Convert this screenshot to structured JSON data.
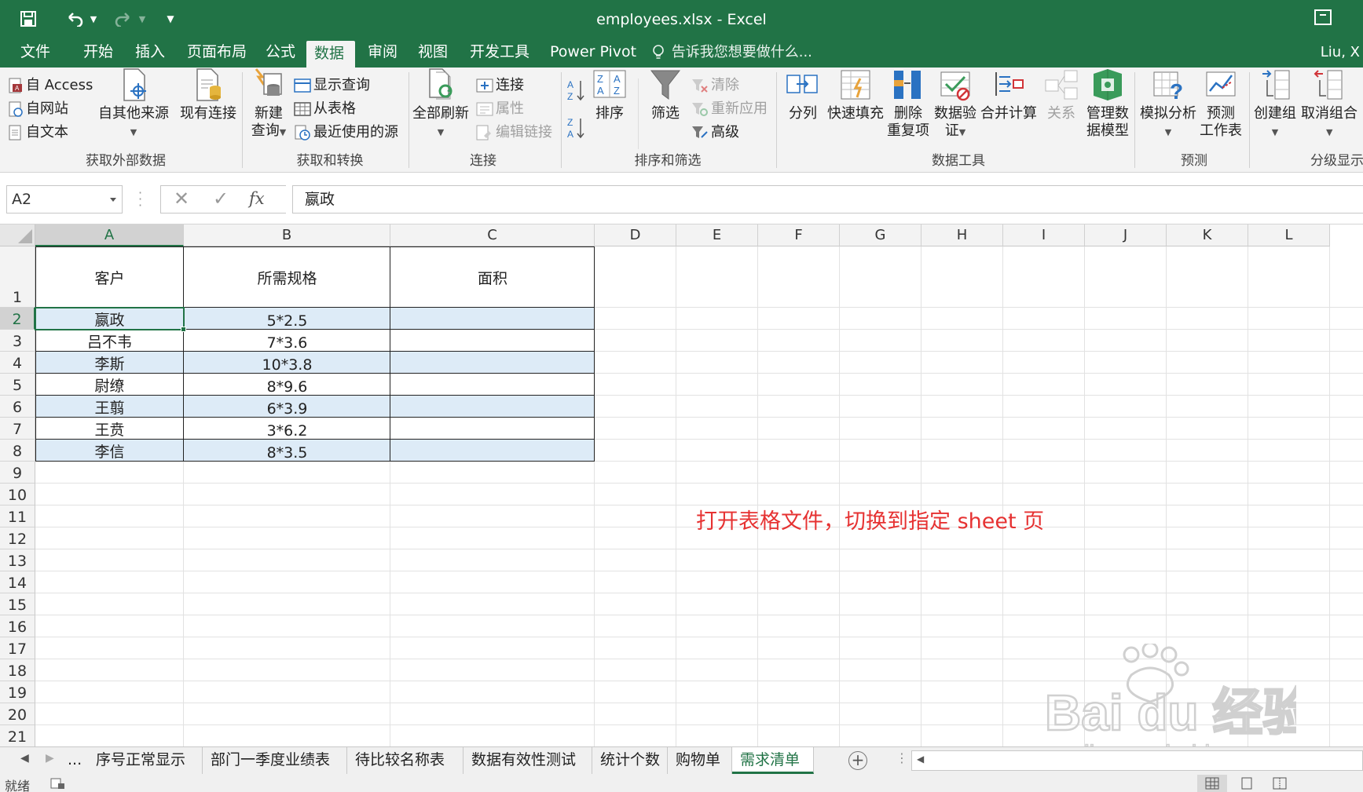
{
  "titlebar": {
    "title": "employees.xlsx - Excel",
    "bg": "#217346"
  },
  "tabs": [
    {
      "label": "文件"
    },
    {
      "label": "开始"
    },
    {
      "label": "插入"
    },
    {
      "label": "页面布局"
    },
    {
      "label": "公式"
    },
    {
      "label": "数据",
      "active": true
    },
    {
      "label": "审阅"
    },
    {
      "label": "视图"
    },
    {
      "label": "开发工具"
    },
    {
      "label": "Power Pivot"
    }
  ],
  "tellme": "告诉我您想要做什么...",
  "user": "Liu, X",
  "ribbon": {
    "external": {
      "access": "自 Access",
      "web": "自网站",
      "text": "自文本",
      "other": "自其他来源",
      "existing": "现有连接",
      "label": "获取外部数据"
    },
    "transform": {
      "new_query_1": "新建",
      "new_query_2": "查询",
      "show_query": "显示查询",
      "from_table": "从表格",
      "recent": "最近使用的源",
      "label": "获取和转换"
    },
    "connections": {
      "refresh_all": "全部刷新",
      "connect": "连接",
      "properties": "属性",
      "edit_links": "编辑链接",
      "label": "连接"
    },
    "sort": {
      "sort": "排序",
      "filter": "筛选",
      "clear": "清除",
      "reapply": "重新应用",
      "advanced": "高级",
      "label": "排序和筛选"
    },
    "tools": {
      "split": "分列",
      "flash": "快速填充",
      "dedupe_1": "删除",
      "dedupe_2": "重复项",
      "validate_1": "数据验",
      "validate_2": "证",
      "consolidate": "合并计算",
      "relations": "关系",
      "model_1": "管理数",
      "model_2": "据模型",
      "label": "数据工具"
    },
    "forecast": {
      "whatif": "模拟分析",
      "sheet_1": "预测",
      "sheet_2": "工作表",
      "label": "预测"
    },
    "outline": {
      "group": "创建组",
      "ungroup": "取消组合",
      "label": "分级显示"
    }
  },
  "formula_bar": {
    "name_box": "A2",
    "fx": "fx",
    "value": "嬴政"
  },
  "grid": {
    "columns": [
      "A",
      "B",
      "C",
      "D",
      "E",
      "F",
      "G",
      "H",
      "I",
      "J",
      "K",
      "L"
    ],
    "rows": [
      "1",
      "2",
      "3",
      "4",
      "5",
      "6",
      "7",
      "8",
      "9",
      "10",
      "11",
      "12",
      "13",
      "14",
      "15",
      "16",
      "17",
      "18",
      "19",
      "20",
      "21"
    ],
    "headers": [
      "客户",
      "所需规格",
      "面积"
    ],
    "data": [
      [
        "嬴政",
        "5*2.5",
        ""
      ],
      [
        "吕不韦",
        "7*3.6",
        ""
      ],
      [
        "李斯",
        "10*3.8",
        ""
      ],
      [
        "尉缭",
        "8*9.6",
        ""
      ],
      [
        "王翦",
        "6*3.9",
        ""
      ],
      [
        "王贲",
        "3*6.2",
        ""
      ],
      [
        "李信",
        "8*3.5",
        ""
      ]
    ],
    "note": "打开表格文件，切换到指定 sheet 页",
    "band_color": "#ddebf7",
    "note_color": "#e63232"
  },
  "sheets": {
    "ellipsis": "...",
    "tabs": [
      "序号正常显示",
      "部门一季度业绩表",
      "待比较名称表",
      "数据有效性测试",
      "统计个数",
      "购物单",
      "需求清单"
    ],
    "active": "需求清单"
  },
  "status": {
    "ready": "就绪"
  },
  "watermark": {
    "brand": "Bai du 经验",
    "url": "jingyan.baidu.com"
  }
}
